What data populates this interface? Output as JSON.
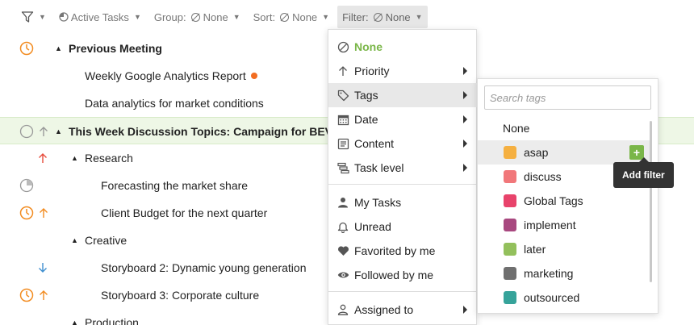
{
  "toolbar": {
    "view": "Active Tasks",
    "group": "Group:",
    "group_value": "None",
    "sort": "Sort:",
    "sort_value": "None",
    "filter": "Filter:",
    "filter_value": "None"
  },
  "tasks": [
    {
      "text": "Previous Meeting"
    },
    {
      "text": "Weekly Google Analytics Report"
    },
    {
      "text": "Data analytics for market conditions"
    },
    {
      "text": "This Week Discussion Topics: Campaign for BEVERA"
    },
    {
      "text": "Research"
    },
    {
      "text": "Forecasting the market share"
    },
    {
      "text": "Client Budget for the next quarter"
    },
    {
      "text": "Creative"
    },
    {
      "text": "Storyboard 2: Dynamic young generation"
    },
    {
      "text": "Storyboard 3: Corporate culture"
    },
    {
      "text": "Production"
    }
  ],
  "filter_menu": {
    "items": [
      {
        "label": "None"
      },
      {
        "label": "Priority"
      },
      {
        "label": "Tags"
      },
      {
        "label": "Date"
      },
      {
        "label": "Content"
      },
      {
        "label": "Task level"
      },
      {
        "label": "My Tasks"
      },
      {
        "label": "Unread"
      },
      {
        "label": "Favorited by me"
      },
      {
        "label": "Followed by me"
      },
      {
        "label": "Assigned to"
      }
    ]
  },
  "tags_menu": {
    "search_placeholder": "Search tags",
    "none_label": "None",
    "items": [
      {
        "label": "asap",
        "color": "#f5b041"
      },
      {
        "label": "discuss",
        "color": "#f1777a"
      },
      {
        "label": "Global Tags",
        "color": "#e8436b"
      },
      {
        "label": "implement",
        "color": "#a8487f"
      },
      {
        "label": "later",
        "color": "#93c05c"
      },
      {
        "label": "marketing",
        "color": "#6f6f6f"
      },
      {
        "label": "outsourced",
        "color": "#36a39a"
      }
    ],
    "add_button": "+",
    "tooltip": "Add filter"
  },
  "colors": {
    "accent_green": "#7ab648",
    "priority_orange": "#f28b1f",
    "priority_red": "#e74c3c",
    "priority_blue": "#3f8fcf"
  }
}
